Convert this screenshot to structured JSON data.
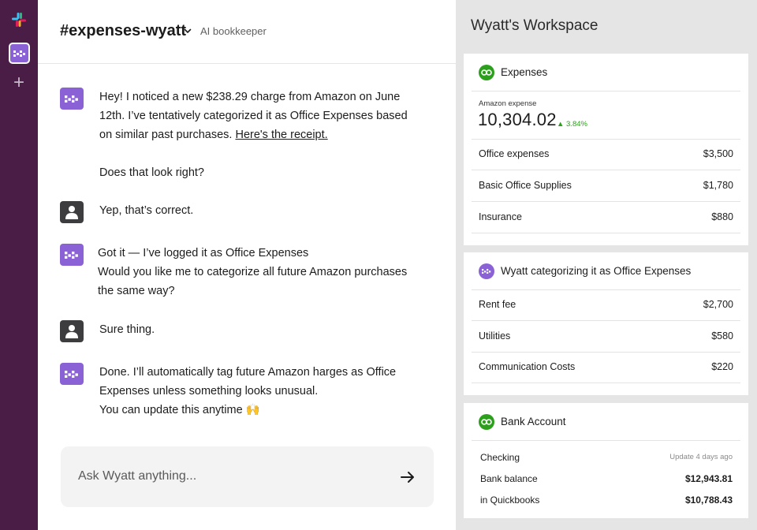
{
  "chat": {
    "channel_name": "#expenses-wyatt",
    "channel_subtitle": "AI bookkeeper",
    "messages": [
      {
        "author": "bot",
        "lines": [
          "Hey! I noticed a new $238.29 charge from Amazon on June",
          "12th. I’ve tentatively categorized it as Office Expenses based",
          "on similar past purchases. "
        ],
        "link": "Here's the receipt.",
        "followup": "Does that look right?"
      },
      {
        "author": "user",
        "lines": [
          "Yep, that’s correct."
        ]
      },
      {
        "author": "bot",
        "lines": [
          "Got it — I’ve logged it as Office Expenses",
          "Would you like me to categorize all future Amazon purchases",
          "the same way?"
        ]
      },
      {
        "author": "user",
        "lines": [
          "Sure thing."
        ]
      },
      {
        "author": "bot",
        "lines": [
          "Done. I’ll automatically tag future Amazon harges as Office",
          "Expenses unless something looks unusual.",
          "You can update this anytime 🙌"
        ]
      }
    ],
    "composer_placeholder": "Ask Wyatt anything..."
  },
  "workspace": {
    "title": "Wyatt's Workspace",
    "expenses_card": {
      "title": "Expenses",
      "metric_label": "Amazon expense",
      "metric_value": "10,304.02",
      "metric_delta": "▲ 3.84%",
      "rows": [
        {
          "label": "Office expenses",
          "value": "$3,500"
        },
        {
          "label": "Basic Office Supplies",
          "value": "$1,780"
        },
        {
          "label": "Insurance",
          "value": "$880"
        }
      ]
    },
    "categorizing_card": {
      "title": "Wyatt categorizing it as Office Expenses",
      "rows": [
        {
          "label": "Rent fee",
          "value": "$2,700"
        },
        {
          "label": "Utilities",
          "value": "$580"
        },
        {
          "label": "Communication Costs",
          "value": "$220"
        }
      ]
    },
    "bank_card": {
      "title": "Bank Account",
      "checking_label": "Checking",
      "updated": "Update 4 days ago",
      "rows": [
        {
          "label": "Bank balance",
          "value": "$12,943.81"
        },
        {
          "label": "in Quickbooks",
          "value": "$10,788.43"
        }
      ]
    }
  },
  "colors": {
    "rail": "#4a1d47",
    "bot_accent": "#8a62d6",
    "quickbooks_green": "#2ca01c",
    "workspace_bg": "#e5e5e5"
  },
  "icons": {
    "rail_logo": "slack-logo-icon",
    "rail_workspace": "wyatt-workspace-icon",
    "rail_add": "plus-icon",
    "bot_avatar": "wyatt-logo-icon",
    "user_avatar": "person-icon",
    "send": "arrow-right-icon",
    "quickbooks": "quickbooks-logo-icon"
  }
}
